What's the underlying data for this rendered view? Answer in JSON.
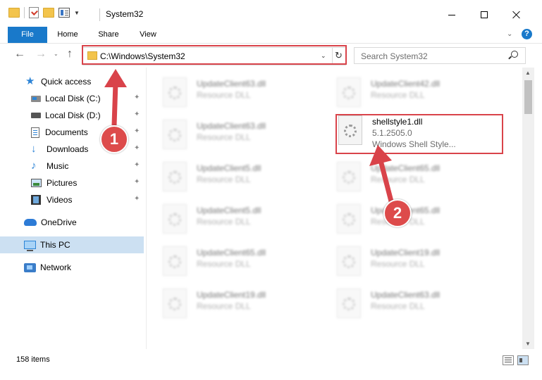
{
  "window": {
    "title": "System32",
    "minimize_label": "",
    "maximize_label": "",
    "close_label": ""
  },
  "ribbon": {
    "tabs": [
      {
        "label": "File"
      },
      {
        "label": "Home"
      },
      {
        "label": "Share"
      },
      {
        "label": "View"
      }
    ],
    "help_label": "?"
  },
  "navigation": {
    "address": "C:\\Windows\\System32",
    "search_placeholder": "Search System32"
  },
  "sidebar": {
    "items": [
      {
        "label": "Quick access",
        "icon": "star-icon"
      },
      {
        "label": "Local Disk (C:)",
        "icon": "local-disk-icon",
        "pinned": true
      },
      {
        "label": "Local Disk (D:)",
        "icon": "local-disk-icon",
        "pinned": true
      },
      {
        "label": "Documents",
        "icon": "documents-icon",
        "pinned": true
      },
      {
        "label": "Downloads",
        "icon": "downloads-icon",
        "pinned": true
      },
      {
        "label": "Music",
        "icon": "music-icon",
        "pinned": true
      },
      {
        "label": "Pictures",
        "icon": "pictures-icon",
        "pinned": true
      },
      {
        "label": "Videos",
        "icon": "videos-icon",
        "pinned": true
      },
      {
        "label": "OneDrive",
        "icon": "onedrive-icon"
      },
      {
        "label": "This PC",
        "icon": "this-pc-icon",
        "selected": true
      },
      {
        "label": "Network",
        "icon": "network-icon"
      }
    ]
  },
  "files": {
    "left_column": [
      {
        "name": "UpdateClient63.dll",
        "sub": "Resource DLL"
      },
      {
        "name": "UpdateClient63.dll",
        "sub": "Resource DLL"
      },
      {
        "name": "UpdateClient5.dll",
        "sub": "Resource DLL"
      },
      {
        "name": "UpdateClient5.dll",
        "sub": "Resource DLL"
      },
      {
        "name": "UpdateClient65.dll",
        "sub": "Resource DLL"
      },
      {
        "name": "UpdateClient19.dll",
        "sub": "Resource DLL"
      }
    ],
    "right_column": [
      {
        "name": "UpdateClient42.dll",
        "sub": "Resource DLL"
      },
      {
        "name": "shellstyle1.dll",
        "sub": "5.1.2505.0",
        "sub2": "Windows Shell Style...",
        "highlighted": true
      },
      {
        "name": "UpdateClient65.dll",
        "sub": "Resource DLL"
      },
      {
        "name": "UpdateClient65.dll",
        "sub": "Resource DLL"
      },
      {
        "name": "UpdateClient19.dll",
        "sub": "Resource DLL"
      },
      {
        "name": "UpdateClient63.dll",
        "sub": "Resource DLL"
      }
    ]
  },
  "status": {
    "item_count": "158 items"
  },
  "callouts": [
    {
      "number": "1"
    },
    {
      "number": "2"
    }
  ],
  "colors": {
    "accent": "#1979ca",
    "highlight": "#d9434a",
    "selection": "#cce0f2"
  }
}
